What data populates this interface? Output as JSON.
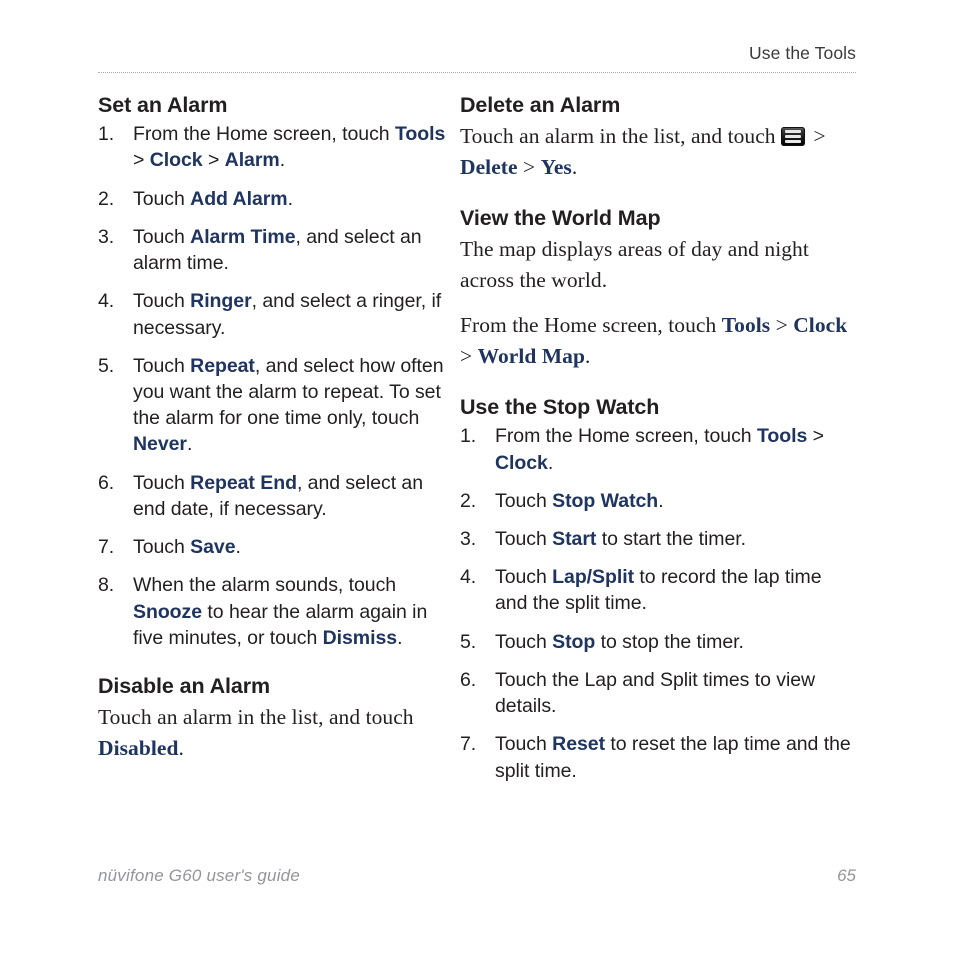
{
  "header": {
    "title": "Use the Tools"
  },
  "footer": {
    "guide_name": "nüvifone G60 user's guide",
    "page_number": "65"
  },
  "colors": {
    "ui_term_blue": "#1F3560",
    "body_text": "#231F20",
    "footer_gray": "#939598",
    "rule_gray": "#A9A9A9"
  },
  "left_column": {
    "section1": {
      "heading": "Set an Alarm",
      "steps": [
        {
          "num": "1.",
          "parts": [
            {
              "t": "text",
              "v": "From the Home screen, touch "
            },
            {
              "t": "ui",
              "v": "Tools"
            },
            {
              "t": "sep",
              "v": " > "
            },
            {
              "t": "ui",
              "v": "Clock"
            },
            {
              "t": "sep",
              "v": " > "
            },
            {
              "t": "ui",
              "v": "Alarm"
            },
            {
              "t": "text",
              "v": "."
            }
          ]
        },
        {
          "num": "2.",
          "parts": [
            {
              "t": "text",
              "v": "Touch "
            },
            {
              "t": "ui",
              "v": "Add Alarm"
            },
            {
              "t": "text",
              "v": "."
            }
          ]
        },
        {
          "num": "3.",
          "parts": [
            {
              "t": "text",
              "v": "Touch "
            },
            {
              "t": "ui",
              "v": "Alarm Time"
            },
            {
              "t": "text",
              "v": ", and select an alarm time."
            }
          ]
        },
        {
          "num": "4.",
          "parts": [
            {
              "t": "text",
              "v": "Touch "
            },
            {
              "t": "ui",
              "v": "Ringer"
            },
            {
              "t": "text",
              "v": ", and select a ringer, if necessary."
            }
          ]
        },
        {
          "num": "5.",
          "parts": [
            {
              "t": "text",
              "v": "Touch "
            },
            {
              "t": "ui",
              "v": "Repeat"
            },
            {
              "t": "text",
              "v": ", and select how often you want the alarm to repeat. To set the alarm for one time only, touch "
            },
            {
              "t": "ui",
              "v": "Never"
            },
            {
              "t": "text",
              "v": "."
            }
          ]
        },
        {
          "num": "6.",
          "parts": [
            {
              "t": "text",
              "v": "Touch "
            },
            {
              "t": "ui",
              "v": "Repeat End"
            },
            {
              "t": "text",
              "v": ", and select an end date, if necessary."
            }
          ]
        },
        {
          "num": "7.",
          "parts": [
            {
              "t": "text",
              "v": "Touch "
            },
            {
              "t": "ui",
              "v": "Save"
            },
            {
              "t": "text",
              "v": "."
            }
          ]
        },
        {
          "num": "8.",
          "parts": [
            {
              "t": "text",
              "v": "When the alarm sounds, touch "
            },
            {
              "t": "ui",
              "v": "Snooze"
            },
            {
              "t": "text",
              "v": " to hear the alarm again in five minutes, or touch "
            },
            {
              "t": "ui",
              "v": "Dismiss"
            },
            {
              "t": "text",
              "v": "."
            }
          ]
        }
      ]
    },
    "section2": {
      "heading": "Disable an Alarm",
      "paragraph_parts": [
        {
          "t": "text",
          "v": "Touch an alarm in the list, and touch "
        },
        {
          "t": "ui",
          "v": "Disabled"
        },
        {
          "t": "text",
          "v": "."
        }
      ]
    }
  },
  "right_column": {
    "section1": {
      "heading": "Delete an Alarm",
      "paragraph_parts": [
        {
          "t": "text",
          "v": "Touch an alarm in the list, and touch "
        },
        {
          "t": "icon",
          "v": "menu-icon"
        },
        {
          "t": "sep",
          "v": " > "
        },
        {
          "t": "ui",
          "v": "Delete"
        },
        {
          "t": "sep",
          "v": " > "
        },
        {
          "t": "ui",
          "v": "Yes"
        },
        {
          "t": "text",
          "v": "."
        }
      ]
    },
    "section2": {
      "heading": "View the World Map",
      "paragraph1_parts": [
        {
          "t": "text",
          "v": "The map displays areas of day and night across the world."
        }
      ],
      "paragraph2_parts": [
        {
          "t": "text",
          "v": "From the Home screen, touch "
        },
        {
          "t": "ui",
          "v": "Tools"
        },
        {
          "t": "sep",
          "v": " > "
        },
        {
          "t": "ui",
          "v": "Clock"
        },
        {
          "t": "sep",
          "v": " > "
        },
        {
          "t": "ui",
          "v": "World Map"
        },
        {
          "t": "text",
          "v": "."
        }
      ]
    },
    "section3": {
      "heading": "Use the Stop Watch",
      "steps": [
        {
          "num": "1.",
          "parts": [
            {
              "t": "text",
              "v": "From the Home screen, touch "
            },
            {
              "t": "ui",
              "v": "Tools"
            },
            {
              "t": "sep",
              "v": " > "
            },
            {
              "t": "ui",
              "v": "Clock"
            },
            {
              "t": "text",
              "v": "."
            }
          ]
        },
        {
          "num": "2.",
          "parts": [
            {
              "t": "text",
              "v": "Touch "
            },
            {
              "t": "ui",
              "v": "Stop Watch"
            },
            {
              "t": "text",
              "v": "."
            }
          ]
        },
        {
          "num": "3.",
          "parts": [
            {
              "t": "text",
              "v": "Touch "
            },
            {
              "t": "ui",
              "v": "Start"
            },
            {
              "t": "text",
              "v": " to start the timer."
            }
          ]
        },
        {
          "num": "4.",
          "parts": [
            {
              "t": "text",
              "v": "Touch "
            },
            {
              "t": "ui",
              "v": "Lap/Split"
            },
            {
              "t": "text",
              "v": " to record the lap time and the split time."
            }
          ]
        },
        {
          "num": "5.",
          "parts": [
            {
              "t": "text",
              "v": "Touch "
            },
            {
              "t": "ui",
              "v": "Stop"
            },
            {
              "t": "text",
              "v": " to stop the timer."
            }
          ]
        },
        {
          "num": "6.",
          "parts": [
            {
              "t": "text",
              "v": "Touch the Lap and Split times to view details."
            }
          ]
        },
        {
          "num": "7.",
          "parts": [
            {
              "t": "text",
              "v": "Touch "
            },
            {
              "t": "ui",
              "v": "Reset"
            },
            {
              "t": "text",
              "v": " to reset the lap time and the split time."
            }
          ]
        }
      ]
    }
  }
}
